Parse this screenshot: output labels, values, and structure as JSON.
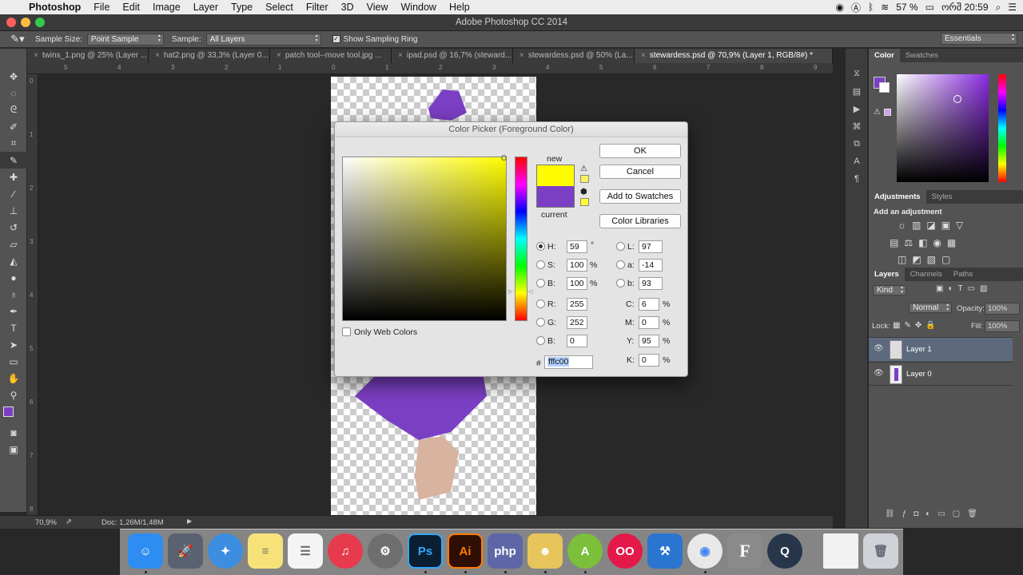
{
  "menubar": {
    "app": "Photoshop",
    "items": [
      "File",
      "Edit",
      "Image",
      "Layer",
      "Type",
      "Select",
      "Filter",
      "3D",
      "View",
      "Window",
      "Help"
    ],
    "battery": "57 %",
    "clock": "ორშ 20:59"
  },
  "window": {
    "title": "Adobe Photoshop CC 2014"
  },
  "options": {
    "sample_size_label": "Sample Size:",
    "sample_size_value": "Point Sample",
    "sample_label": "Sample:",
    "sample_value": "All Layers",
    "show_ring_label": "Show Sampling Ring",
    "workspace": "Essentials"
  },
  "tabs": [
    "twins_1.png @ 25% (Layer ...",
    "hat2.png @ 33,3% (Layer 0...",
    "patch tool--move tool.jpg ...",
    "ipad.psd @ 16,7% (steward...",
    "stewardess.psd @ 50% (La...",
    "stewardess.psd @ 70,9% (Layer 1, RGB/8#) *"
  ],
  "status": {
    "zoom": "70,9%",
    "doc": "Doc: 1,26M/1,48M"
  },
  "ruler_h": [
    "5",
    "4",
    "3",
    "2",
    "1",
    "0",
    "1",
    "2",
    "3",
    "4",
    "5",
    "6",
    "7",
    "8",
    "9"
  ],
  "ruler_v": [
    "0",
    "1",
    "2",
    "3",
    "4",
    "5",
    "6",
    "7",
    "8"
  ],
  "panels": {
    "color_tab": "Color",
    "swatches_tab": "Swatches",
    "adjustments_tab": "Adjustments",
    "styles_tab": "Styles",
    "add_adjustment": "Add an adjustment",
    "layers_tab": "Layers",
    "channels_tab": "Channels",
    "paths_tab": "Paths",
    "kind": "Kind",
    "blend": "Normal",
    "opacity_label": "Opacity:",
    "opacity_value": "100%",
    "lock_label": "Lock:",
    "fill_label": "Fill:",
    "fill_value": "100%",
    "layers": [
      "Layer 1",
      "Layer 0"
    ]
  },
  "dialog": {
    "title": "Color Picker (Foreground Color)",
    "ok": "OK",
    "cancel": "Cancel",
    "add_swatches": "Add to Swatches",
    "color_libraries": "Color Libraries",
    "new_label": "new",
    "current_label": "current",
    "only_web": "Only Web Colors",
    "h_label": "H:",
    "h_value": "59",
    "h_unit": "°",
    "s_label": "S:",
    "s_value": "100",
    "s_unit": "%",
    "b_label": "B:",
    "b_value": "100",
    "b_unit": "%",
    "r_label": "R:",
    "r_value": "255",
    "g_label": "G:",
    "g_value": "252",
    "bb_label": "B:",
    "bb_value": "0",
    "l_label": "L:",
    "l_value": "97",
    "a_label": "a:",
    "a_value": "-14",
    "lb_label": "b:",
    "lb_value": "93",
    "c_label": "C:",
    "c_value": "6",
    "m_label": "M:",
    "m_value": "0",
    "y_label": "Y:",
    "y_value": "95",
    "k_label": "K:",
    "k_value": "0",
    "pct": "%",
    "hash": "#",
    "hex_value": "fffc00"
  },
  "colors": {
    "new": "#fffc00",
    "current": "#7b3fc4",
    "foreground": "#7b3fc4"
  },
  "dock": [
    "Finder",
    "Launchpad",
    "Safari",
    "Notes",
    "Reminders",
    "iTunes",
    "System Preferences",
    "Ps",
    "Ai",
    "php",
    "Growl",
    "Android Studio",
    "Flickr",
    "Xcode",
    "Chrome",
    "Font Book",
    "QuickTime",
    "Document",
    "Trash"
  ]
}
